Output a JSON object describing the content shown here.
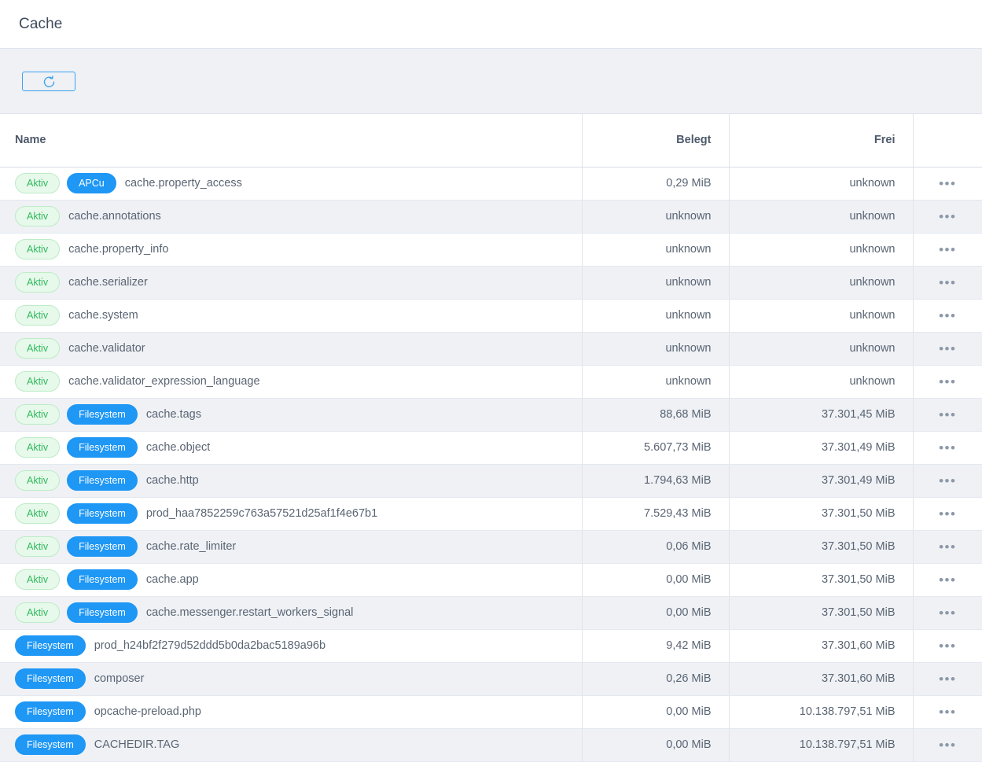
{
  "header": {
    "title": "Cache"
  },
  "toolbar": {
    "refresh_icon": "refresh-ccw-icon",
    "refresh_label": ""
  },
  "colors": {
    "accent_blue": "#1e97f5",
    "badge_active_bg": "#e6f9ea",
    "badge_active_text": "#33b860",
    "badge_active_border": "#bdecc7",
    "row_stripe": "#eff1f5",
    "toolbar_bg": "#eff1f5",
    "border": "#dfe3eb",
    "text": "#5a6573",
    "title_text": "#3f4b5b"
  },
  "table": {
    "columns": [
      {
        "key": "name",
        "label": "Name",
        "align": "left"
      },
      {
        "key": "used",
        "label": "Belegt",
        "align": "right"
      },
      {
        "key": "free",
        "label": "Frei",
        "align": "right"
      },
      {
        "key": "actions",
        "label": "",
        "align": "center"
      }
    ],
    "row_menu_glyph": "•••",
    "rows": [
      {
        "status": "Aktiv",
        "pool": "APCu",
        "name": "cache.property_access",
        "used": "0,29 MiB",
        "free": "unknown"
      },
      {
        "status": "Aktiv",
        "pool": "",
        "name": "cache.annotations",
        "used": "unknown",
        "free": "unknown"
      },
      {
        "status": "Aktiv",
        "pool": "",
        "name": "cache.property_info",
        "used": "unknown",
        "free": "unknown"
      },
      {
        "status": "Aktiv",
        "pool": "",
        "name": "cache.serializer",
        "used": "unknown",
        "free": "unknown"
      },
      {
        "status": "Aktiv",
        "pool": "",
        "name": "cache.system",
        "used": "unknown",
        "free": "unknown"
      },
      {
        "status": "Aktiv",
        "pool": "",
        "name": "cache.validator",
        "used": "unknown",
        "free": "unknown"
      },
      {
        "status": "Aktiv",
        "pool": "",
        "name": "cache.validator_expression_language",
        "used": "unknown",
        "free": "unknown"
      },
      {
        "status": "Aktiv",
        "pool": "Filesystem",
        "name": "cache.tags",
        "used": "88,68 MiB",
        "free": "37.301,45 MiB"
      },
      {
        "status": "Aktiv",
        "pool": "Filesystem",
        "name": "cache.object",
        "used": "5.607,73 MiB",
        "free": "37.301,49 MiB"
      },
      {
        "status": "Aktiv",
        "pool": "Filesystem",
        "name": "cache.http",
        "used": "1.794,63 MiB",
        "free": "37.301,49 MiB"
      },
      {
        "status": "Aktiv",
        "pool": "Filesystem",
        "name": "prod_haa7852259c763a57521d25af1f4e67b1",
        "used": "7.529,43 MiB",
        "free": "37.301,50 MiB"
      },
      {
        "status": "Aktiv",
        "pool": "Filesystem",
        "name": "cache.rate_limiter",
        "used": "0,06 MiB",
        "free": "37.301,50 MiB"
      },
      {
        "status": "Aktiv",
        "pool": "Filesystem",
        "name": "cache.app",
        "used": "0,00 MiB",
        "free": "37.301,50 MiB"
      },
      {
        "status": "Aktiv",
        "pool": "Filesystem",
        "name": "cache.messenger.restart_workers_signal",
        "used": "0,00 MiB",
        "free": "37.301,50 MiB"
      },
      {
        "status": "",
        "pool": "Filesystem",
        "name": "prod_h24bf2f279d52ddd5b0da2bac5189a96b",
        "used": "9,42 MiB",
        "free": "37.301,60 MiB"
      },
      {
        "status": "",
        "pool": "Filesystem",
        "name": "composer",
        "used": "0,26 MiB",
        "free": "37.301,60 MiB"
      },
      {
        "status": "",
        "pool": "Filesystem",
        "name": "opcache-preload.php",
        "used": "0,00 MiB",
        "free": "10.138.797,51 MiB"
      },
      {
        "status": "",
        "pool": "Filesystem",
        "name": "CACHEDIR.TAG",
        "used": "0,00 MiB",
        "free": "10.138.797,51 MiB"
      }
    ]
  }
}
